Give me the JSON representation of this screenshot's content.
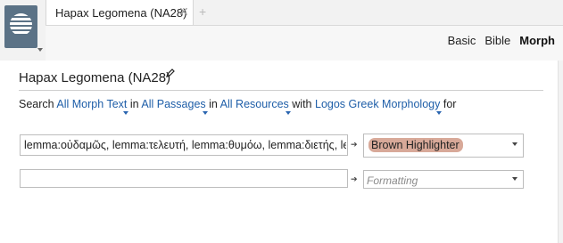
{
  "tab": {
    "title": "Hapax Legomena (NA28)",
    "close_glyph": "✕",
    "new_tab_glyph": "+"
  },
  "modes": [
    {
      "label": "Basic",
      "active": false
    },
    {
      "label": "Bible",
      "active": false
    },
    {
      "label": "Morph",
      "active": true
    }
  ],
  "page": {
    "title": "Hapax Legomena (NA28)"
  },
  "search": {
    "prefix": "Search",
    "morph_text": "All Morph Text",
    "in1": "in",
    "passages": "All Passages",
    "in2": "in",
    "resources": "All Resources",
    "with": "with",
    "morphology": "Logos Greek Morphology",
    "for": "for"
  },
  "rows": [
    {
      "query": "lemma:οὐδαμῶς, lemma:τελευτή, lemma:θυμόω, lemma:διετής, le",
      "highlight": "Brown Highlighter"
    },
    {
      "query": "",
      "highlight_placeholder": "Formatting"
    }
  ],
  "arrow_glyph": "➔",
  "colors": {
    "link": "#1e5ea8",
    "highlight": "#d8a999",
    "logo": "#5b7286"
  },
  "icons": [
    "app-menu-icon",
    "close-icon",
    "new-tab-icon",
    "edit-pencil-icon",
    "arrow-right-icon",
    "chevron-down-icon"
  ]
}
